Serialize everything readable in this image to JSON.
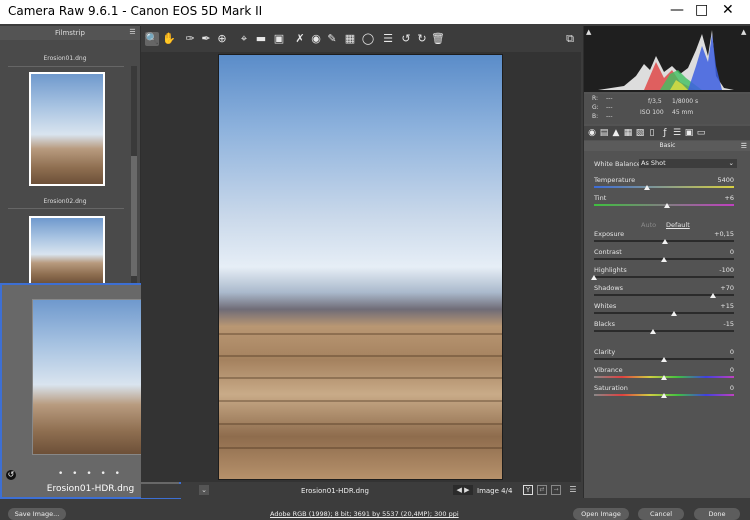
{
  "window": {
    "title": "Camera Raw 9.6.1  -  Canon EOS 5D Mark II",
    "minimize_icon": "minimize-icon",
    "maximize_icon": "maximize-icon",
    "close_icon": "close-icon"
  },
  "filmstrip": {
    "header": "Filmstrip",
    "items": [
      {
        "name": "Erosion01.dng"
      },
      {
        "name": "Erosion02.dng"
      }
    ],
    "selected": {
      "name": "Erosion01-HDR.dng",
      "rating_dots": "• • • • •"
    }
  },
  "toolbar": {
    "tools": [
      "zoom-tool-icon",
      "hand-tool-icon",
      "white-balance-tool-icon",
      "color-sampler-tool-icon",
      "targeted-adjustment-tool-icon",
      "crop-tool-icon",
      "straighten-tool-icon",
      "transform-tool-icon",
      "spot-removal-tool-icon",
      "red-eye-removal-tool-icon",
      "adjustment-brush-icon",
      "graduated-filter-icon",
      "radial-filter-icon",
      "preferences-icon",
      "rotate-left-icon",
      "rotate-right-icon",
      "trash-icon"
    ],
    "fullscreen_icon": "fullscreen-icon"
  },
  "image_nav": {
    "filename": "Erosion01-HDR.dng",
    "counter": "Image 4/4",
    "y_toggle": "Y"
  },
  "histogram": {
    "rgb_labels": [
      "R:",
      "G:",
      "B:"
    ],
    "rgb_values": [
      "---",
      "---",
      "---"
    ],
    "aperture": "f/3,5",
    "shutter": "1/8000 s",
    "iso": "ISO 100",
    "focal": "45 mm"
  },
  "panel": {
    "title": "Basic",
    "white_balance_label": "White Balance:",
    "white_balance_value": "As Shot",
    "auto_label": "Auto",
    "default_label": "Default",
    "sliders": [
      {
        "label": "Temperature",
        "value": "5400",
        "pos": 0.38
      },
      {
        "label": "Tint",
        "value": "+6",
        "pos": 0.52
      },
      {
        "label": "Exposure",
        "value": "+0,15",
        "pos": 0.51
      },
      {
        "label": "Contrast",
        "value": "0",
        "pos": 0.5
      },
      {
        "label": "Highlights",
        "value": "-100",
        "pos": 0.0
      },
      {
        "label": "Shadows",
        "value": "+70",
        "pos": 0.85
      },
      {
        "label": "Whites",
        "value": "+15",
        "pos": 0.57
      },
      {
        "label": "Blacks",
        "value": "-15",
        "pos": 0.42
      },
      {
        "label": "Clarity",
        "value": "0",
        "pos": 0.5
      },
      {
        "label": "Vibrance",
        "value": "0",
        "pos": 0.5
      },
      {
        "label": "Saturation",
        "value": "0",
        "pos": 0.5
      }
    ]
  },
  "footer": {
    "save_button": "Save Image...",
    "workflow_link": "Adobe RGB (1998); 8 bit; 3691 by 5537 (20,4MP); 300 ppi",
    "open_button": "Open Image",
    "cancel_button": "Cancel",
    "done_button": "Done"
  },
  "colors": {
    "accent": "#3d6fd3",
    "panel_bg": "#535353",
    "filmstrip_bg": "#4a4a4a"
  }
}
